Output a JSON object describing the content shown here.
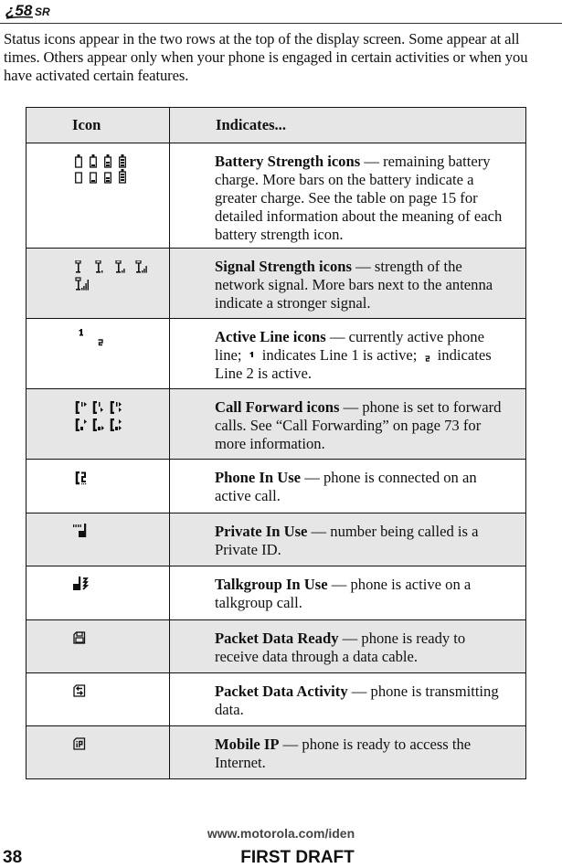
{
  "header": {
    "logo_text": "i58sr"
  },
  "intro": "Status icons appear in the two rows at the top of the display screen. Some appear at all times. Others appear only when your phone is engaged in certain activities or when you have activated certain features.",
  "table": {
    "columns": [
      "Icon",
      "Indicates..."
    ],
    "rows": [
      {
        "icon": "battery-strength-icons",
        "title": "Battery Strength icons",
        "description": " — remaining battery charge. More bars on the battery indicate a greater charge. See the table on page 15 for detailed information about the meaning of each battery strength icon."
      },
      {
        "icon": "signal-strength-icons",
        "title": "Signal Strength icons",
        "description": " — strength of the network signal. More bars next to the antenna indicate a stronger signal."
      },
      {
        "icon": "active-line-icons",
        "title": "Active Line icons",
        "description_parts": [
          " — currently active phone line; ",
          " indicates Line 1 is active; ",
          " indicates Line 2 is active."
        ]
      },
      {
        "icon": "call-forward-icons",
        "title": "Call Forward icons",
        "description": " — phone is set to forward calls. See “Call Forwarding” on page 73 for more information."
      },
      {
        "icon": "phone-in-use-icon",
        "title": "Phone In Use",
        "description": " — phone is connected on an active call."
      },
      {
        "icon": "private-in-use-icon",
        "title": "Private In Use",
        "description": " — number being called is a Private ID."
      },
      {
        "icon": "talkgroup-in-use-icon",
        "title": "Talkgroup In Use",
        "description": " — phone is active on a talkgroup call."
      },
      {
        "icon": "packet-data-ready-icon",
        "title": "Packet Data Ready",
        "description": " — phone is ready to receive data through a data cable."
      },
      {
        "icon": "packet-data-activity-icon",
        "title": "Packet Data Activity",
        "description": " — phone is transmitting data."
      },
      {
        "icon": "mobile-ip-icon",
        "title": "Mobile IP",
        "description": " — phone is ready to access the Internet."
      }
    ]
  },
  "footer": {
    "url": "www.motorola.com/iden",
    "page_number": "38",
    "draft_label": "FIRST DRAFT"
  }
}
